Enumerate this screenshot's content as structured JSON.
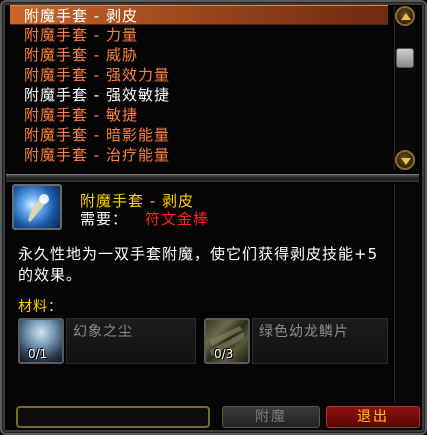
{
  "recipe_list": {
    "items": [
      {
        "label": "附魔手套 - 剥皮",
        "color": "#ffffff",
        "selected": true
      },
      {
        "label": "附魔手套 - 力量",
        "color": "#ff8040",
        "selected": false
      },
      {
        "label": "附魔手套 - 威胁",
        "color": "#ff8040",
        "selected": false
      },
      {
        "label": "附魔手套 - 强效力量",
        "color": "#ff8040",
        "selected": false
      },
      {
        "label": "附魔手套 - 强效敏捷",
        "color": "#ffffff",
        "selected": false
      },
      {
        "label": "附魔手套 - 敏捷",
        "color": "#ff8040",
        "selected": false
      },
      {
        "label": "附魔手套 - 暗影能量",
        "color": "#ff8040",
        "selected": false
      },
      {
        "label": "附魔手套 - 治疗能量",
        "color": "#ff8040",
        "selected": false
      }
    ]
  },
  "detail": {
    "title": "附魔手套 - 剥皮",
    "requires_label": "需要：",
    "requires_value": "符文金棒",
    "description": "永久性地为一双手套附魔，使它们获得剥皮技能+5的效果。",
    "materials_label": "材料：",
    "reagents": [
      {
        "name": "幻象之尘",
        "count": "0/1",
        "icon": "illusion-dust-icon"
      },
      {
        "name": "绿色幼龙鳞片",
        "count": "0/3",
        "icon": "green-whelp-scale-icon"
      }
    ]
  },
  "buttons": {
    "enchant": "附魔",
    "exit": "退出"
  },
  "colors": {
    "selected_row": "#c9662c",
    "orange_text": "#ff8040",
    "yellow_text": "#ffd200",
    "red_text": "#ff2020"
  }
}
